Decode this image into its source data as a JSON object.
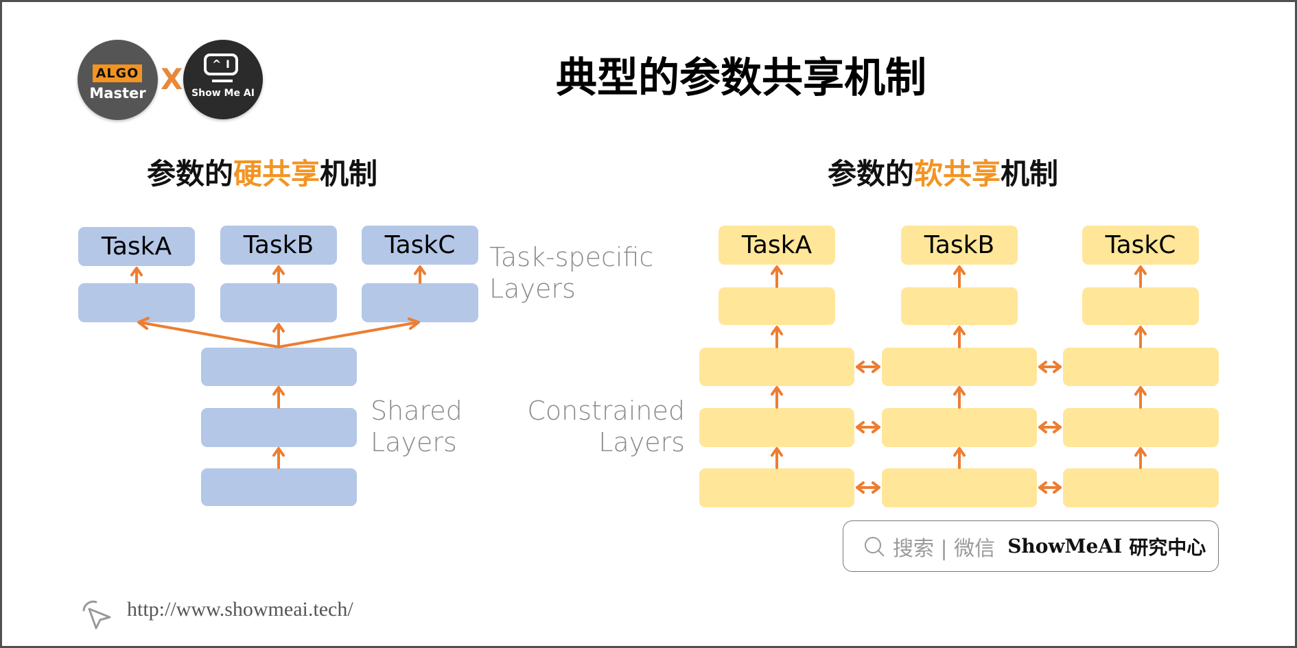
{
  "logos": {
    "left": {
      "tag": "ALGO",
      "name": "Master"
    },
    "separator": "X",
    "right": {
      "screen_text_left": "^",
      "screen_text_right": "I",
      "name": "Show Me AI"
    }
  },
  "title": "典型的参数共享机制",
  "hard_sharing": {
    "subtitle_prefix": "参数的",
    "subtitle_highlight": "硬共享",
    "subtitle_suffix": "机制",
    "tasks": [
      "TaskA",
      "TaskB",
      "TaskC"
    ],
    "task_specific_label": [
      "Task-specific",
      "Layers"
    ],
    "shared_label": [
      "Shared",
      "Layers"
    ],
    "shared_layer_count": 3
  },
  "soft_sharing": {
    "subtitle_prefix": "参数的",
    "subtitle_highlight": "软共享",
    "subtitle_suffix": "机制",
    "tasks": [
      "TaskA",
      "TaskB",
      "TaskC"
    ],
    "constrained_label": [
      "Constrained",
      "Layers"
    ],
    "constrained_layer_count": 3
  },
  "search": {
    "icon": "search-icon",
    "hint": "搜索 | 微信",
    "brand": "ShowMeAI",
    "brand_cn": "研究中心"
  },
  "footer": {
    "icon": "cursor-click-icon",
    "url": "http://www.showmeai.tech/"
  },
  "colors": {
    "accent": "#F39422",
    "arrow": "#ED7D31",
    "hard_box": "#B4C7E7",
    "soft_box": "#FFE699",
    "label_gray": "#8a8a8a"
  }
}
